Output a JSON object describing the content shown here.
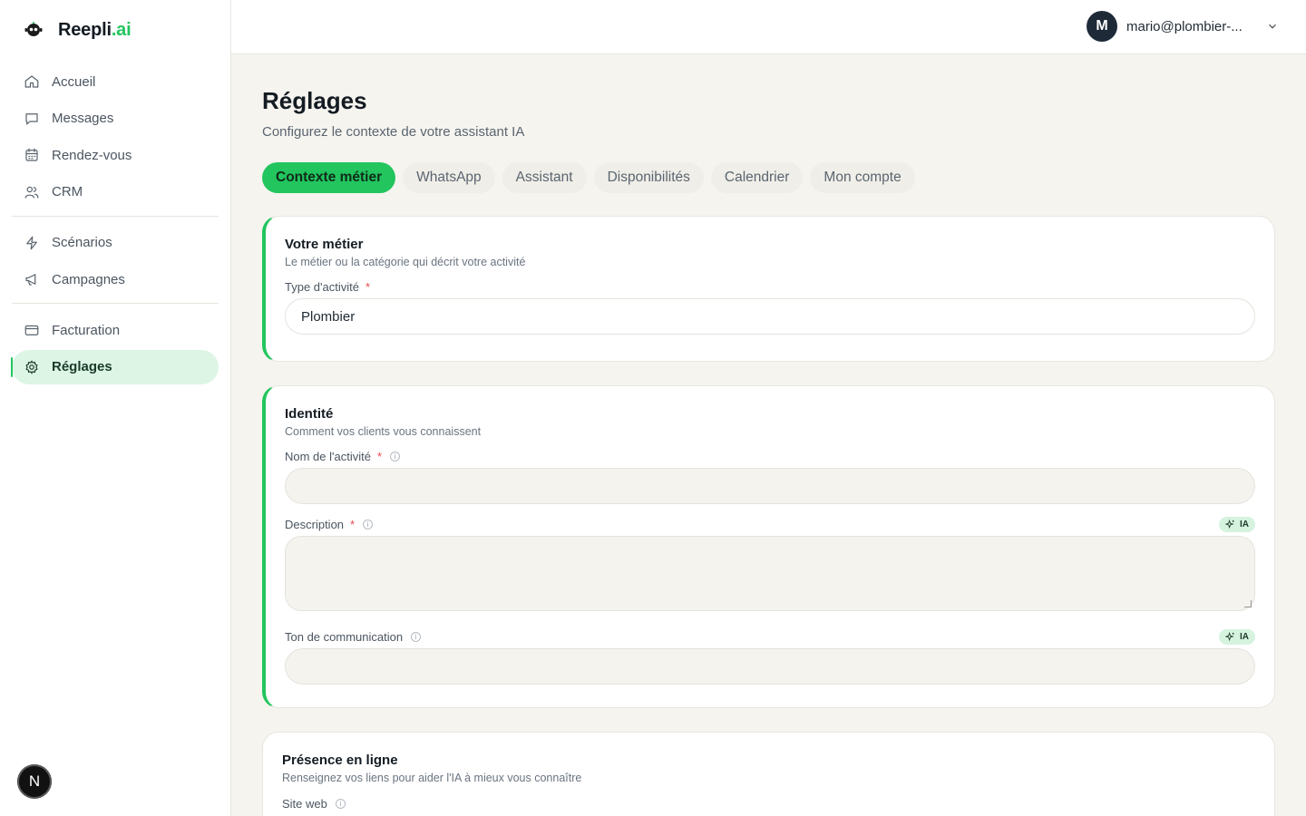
{
  "brand": {
    "name_main": "Reepli",
    "name_accent": ".ai"
  },
  "nav": {
    "items": [
      {
        "label": "Accueil",
        "icon": "home-icon"
      },
      {
        "label": "Messages",
        "icon": "message-icon"
      },
      {
        "label": "Rendez-vous",
        "icon": "calendar-icon"
      },
      {
        "label": "CRM",
        "icon": "users-icon"
      }
    ],
    "items2": [
      {
        "label": "Scénarios",
        "icon": "bolt-icon"
      },
      {
        "label": "Campagnes",
        "icon": "megaphone-icon"
      }
    ],
    "items3": [
      {
        "label": "Facturation",
        "icon": "credit-card-icon"
      },
      {
        "label": "Réglages",
        "icon": "gear-icon",
        "active": true
      }
    ],
    "bottom_badge": "N"
  },
  "account": {
    "initial": "M",
    "email": "mario@plombier-..."
  },
  "page": {
    "title": "Réglages",
    "subtitle": "Configurez le contexte de votre assistant IA"
  },
  "tabs": [
    {
      "label": "Contexte métier",
      "active": true
    },
    {
      "label": "WhatsApp"
    },
    {
      "label": "Assistant"
    },
    {
      "label": "Disponibilités"
    },
    {
      "label": "Calendrier"
    },
    {
      "label": "Mon compte"
    }
  ],
  "cards": {
    "metier": {
      "title": "Votre métier",
      "desc": "Le métier ou la catégorie qui décrit votre activité",
      "field_label": "Type d'activité",
      "required": "*",
      "value": "Plombier"
    },
    "identite": {
      "title": "Identité",
      "desc": "Comment vos clients vous connaissent",
      "name_label": "Nom de l'activité",
      "description_label": "Description",
      "ton_label": "Ton de communication",
      "required": "*",
      "ia_badge": "IA",
      "name_value": "",
      "description_value": "",
      "ton_value": ""
    },
    "presence": {
      "title": "Présence en ligne",
      "desc": "Renseignez vos liens pour aider l'IA à mieux vous connaître",
      "site_label": "Site web"
    }
  },
  "colors": {
    "accent": "#22c55e",
    "active_bg": "#dcf5e5",
    "page_bg": "#f6f4ef"
  }
}
